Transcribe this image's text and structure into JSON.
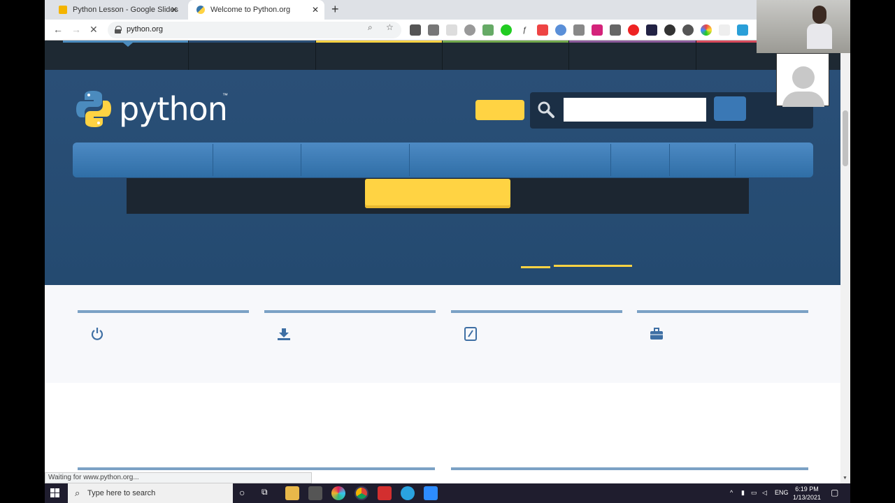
{
  "browser": {
    "tabs": [
      {
        "title": "Python Lesson - Google Slides",
        "active": false
      },
      {
        "title": "Welcome to Python.org",
        "active": true
      }
    ],
    "url": "python.org",
    "status": "Waiting for www.python.org..."
  },
  "page": {
    "logo_text": "python",
    "logo_tm": "™"
  },
  "taskbar": {
    "search_placeholder": "Type here to search",
    "language": "ENG",
    "time": "6:19 PM",
    "date": "1/13/2021"
  },
  "colors": {
    "accent_yellow": "#ffd343",
    "python_blue": "#2a4f77",
    "nav_blue": "#4d8ac4"
  }
}
